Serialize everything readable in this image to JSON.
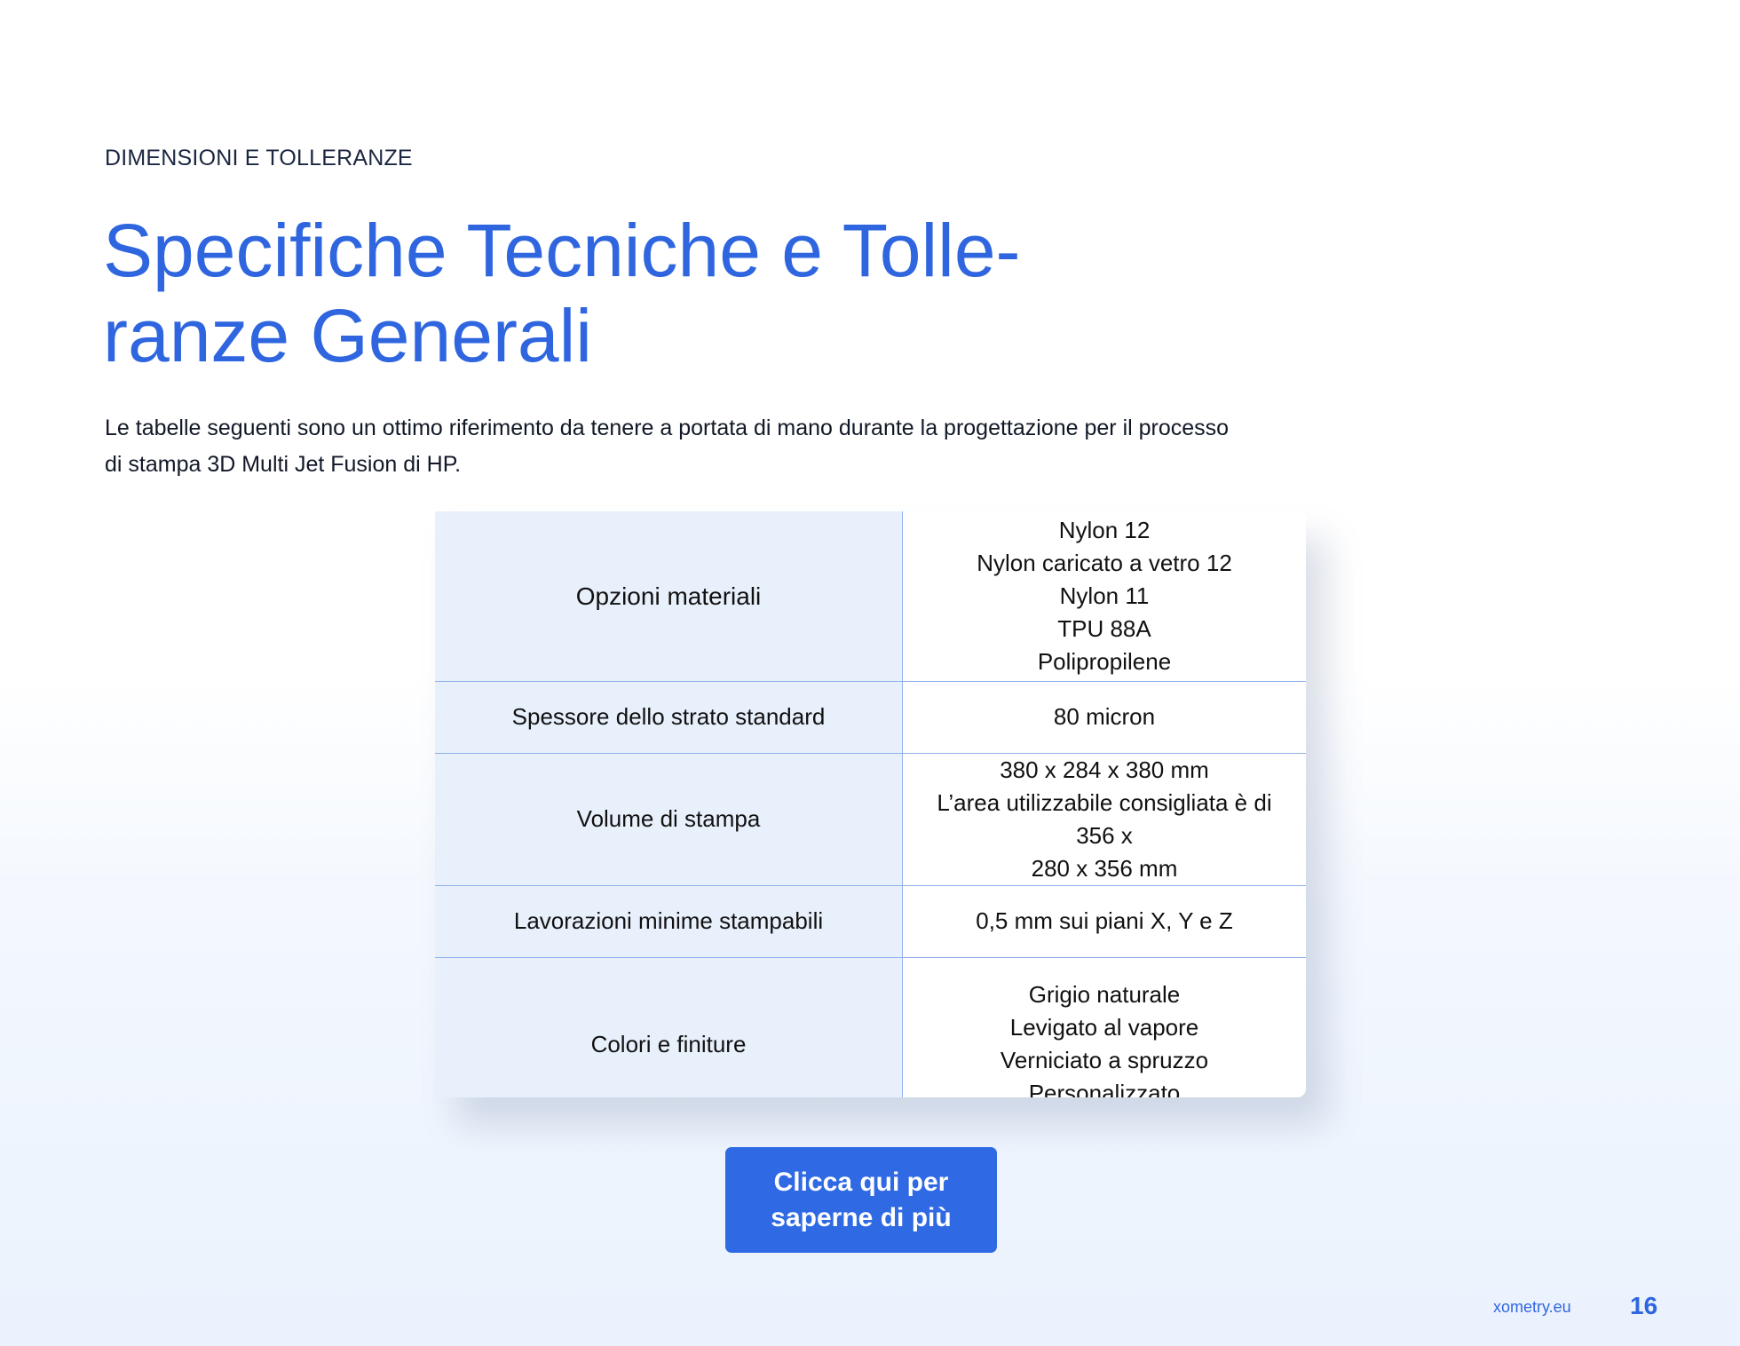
{
  "header": {
    "section_label": "DIMENSIONI E TOLLERANZE",
    "title_line_1": "Specifiche Tecniche e Tolle-",
    "title_line_2": "ranze Generali"
  },
  "intro": {
    "line_1": "Le tabelle seguenti sono un ottimo riferimento da tenere a portata di mano durante la progettazione per il processo",
    "line_2": "di stampa 3D Multi Jet Fusion di HP."
  },
  "spec_table": {
    "rows": [
      {
        "label": "Opzioni materiali",
        "values": [
          "Nylon 12",
          "Nylon caricato a vetro 12",
          "Nylon 11",
          "TPU 88A",
          "Polipropilene"
        ]
      },
      {
        "label": "Spessore dello strato standard",
        "values": [
          "80 micron"
        ]
      },
      {
        "label": "Volume di stampa",
        "values": [
          "380 x 284 x 380 mm",
          "L’area utilizzabile consigliata è di 356 x",
          "280 x 356 mm"
        ]
      },
      {
        "label": "Lavorazioni minime stampabili",
        "values": [
          "0,5 mm sui piani X, Y e Z"
        ]
      },
      {
        "label": "Colori e finiture",
        "values": [
          "Grigio naturale",
          "Levigato al vapore",
          "Verniciato a spruzzo",
          "Personalizzato"
        ]
      }
    ]
  },
  "cta": {
    "line_1": "Clicca qui per",
    "line_2": "saperne di più"
  },
  "footer": {
    "site": "xometry.eu",
    "page_number": "16"
  },
  "colors": {
    "accent_blue": "#2f66df",
    "label_cell_bg": "#e8f0fb",
    "table_border": "#8fb0ea",
    "button_bg": "#2f69e3"
  }
}
